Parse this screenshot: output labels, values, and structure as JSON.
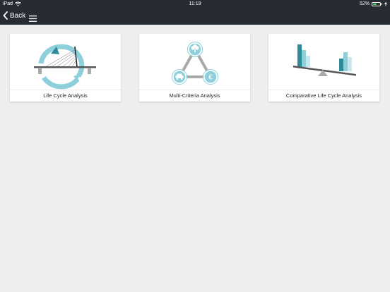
{
  "status_bar": {
    "device": "iPad",
    "time": "11:19",
    "battery": "52%",
    "battery_level": 0.52,
    "wifi_icon": "wifi-icon",
    "battery_icon": "battery-icon",
    "charging_icon": "charging-icon"
  },
  "nav": {
    "back_label": "Back",
    "back_icon": "chevron-left-icon",
    "menu_icon": "hamburger-menu-icon"
  },
  "cards": [
    {
      "label": "Life Cycle Analysis",
      "icon": "bridge-lifecycle-icon"
    },
    {
      "label": "Multi-Criteria Analysis",
      "icon": "triangle-criteria-icon"
    },
    {
      "label": "Comparative Life Cycle Analysis",
      "icon": "seesaw-bars-icon"
    }
  ],
  "colors": {
    "header": "#262b34",
    "background": "#efeeee",
    "accent_light": "#8ecfdc",
    "accent_dark": "#2e8b9a",
    "gray": "#888888"
  }
}
